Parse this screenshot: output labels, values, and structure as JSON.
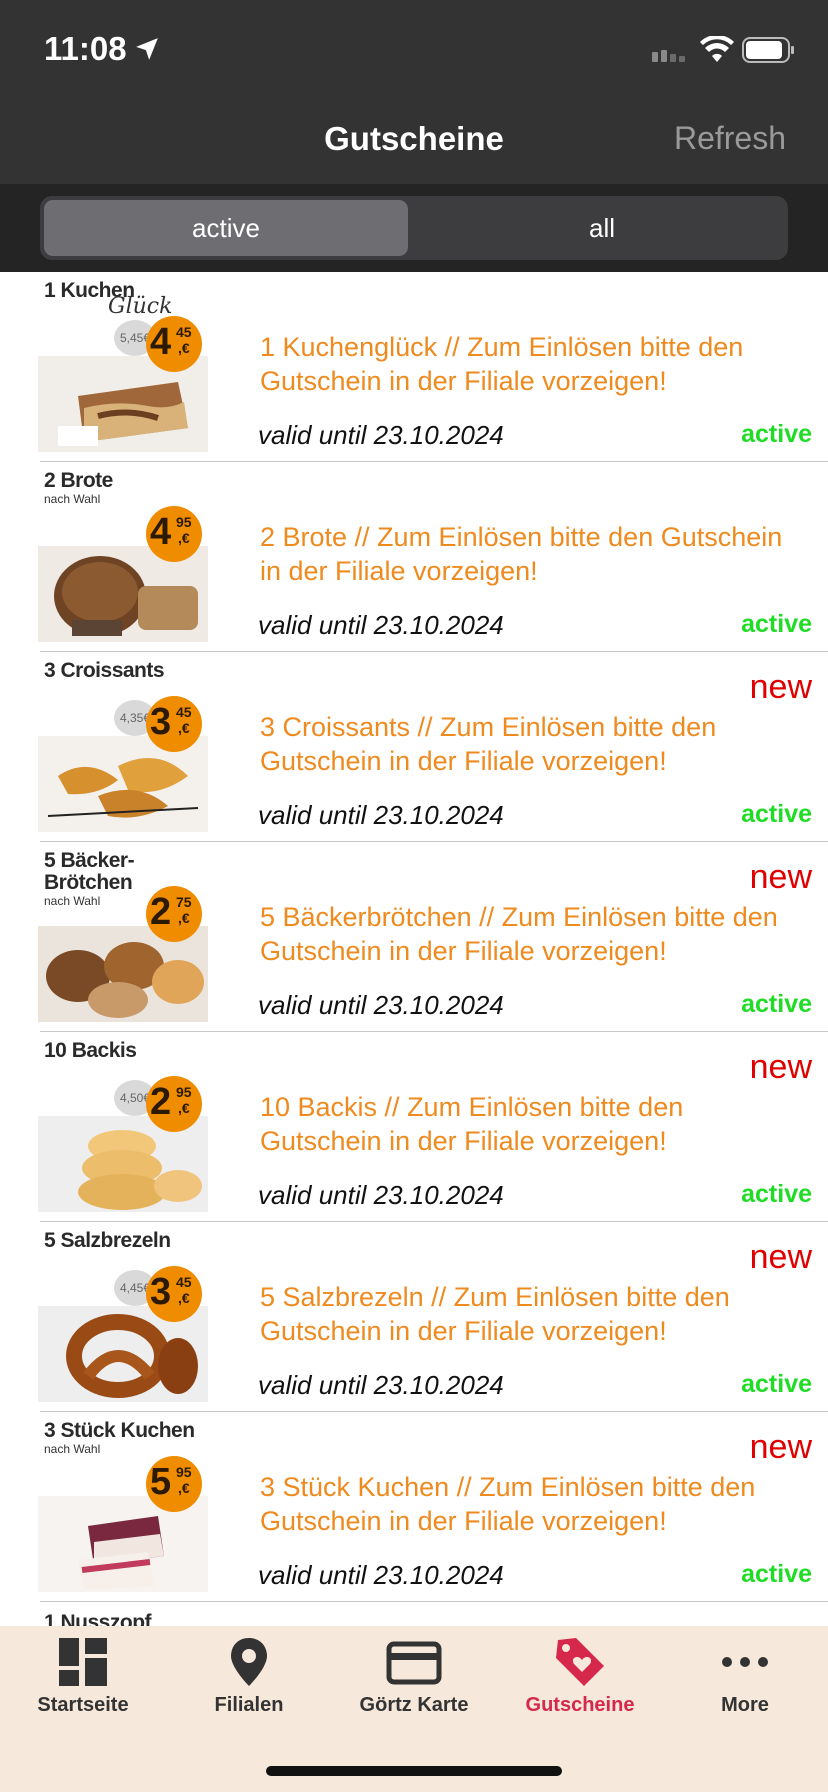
{
  "status_bar": {
    "time": "11:08"
  },
  "nav": {
    "title": "Gutscheine",
    "refresh_label": "Refresh"
  },
  "segments": {
    "active": "active",
    "all": "all"
  },
  "coupons": [
    {
      "image_label": "1 Kuchen",
      "image_script": "Glück",
      "price_main": "4",
      "price_cents": "45",
      "old_price": "5,45€",
      "title": "1 Kuchenglück // Zum Einlösen bitte den Gutschein in der Filiale vorzeigen!",
      "valid": "valid until 23.10.2024",
      "status": "active",
      "is_new": false,
      "new_label": ""
    },
    {
      "image_label": "2 Brote",
      "image_sub": "nach Wahl",
      "price_main": "4",
      "price_cents": "95",
      "old_price": "",
      "title": "2 Brote // Zum Einlösen bitte den Gutschein in der Filiale vorzeigen!",
      "valid": "valid until 23.10.2024",
      "status": "active",
      "is_new": false,
      "new_label": ""
    },
    {
      "image_label": "3 Croissants",
      "price_main": "3",
      "price_cents": "45",
      "old_price": "4,35€",
      "title": "3 Croissants // Zum Einlösen bitte den Gutschein in der Filiale vorzeigen!",
      "valid": "valid until 23.10.2024",
      "status": "active",
      "is_new": true,
      "new_label": "new"
    },
    {
      "image_label": "5 Bäcker-\nBrötchen",
      "image_sub": "nach Wahl",
      "price_main": "2",
      "price_cents": "75",
      "old_price": "",
      "title": "5 Bäckerbrötchen // Zum Einlösen bitte den Gutschein in der Filiale vorzeigen!",
      "valid": "valid until 23.10.2024",
      "status": "active",
      "is_new": true,
      "new_label": "new"
    },
    {
      "image_label": "10 Backis",
      "price_main": "2",
      "price_cents": "95",
      "old_price": "4,50€",
      "title": "10 Backis // Zum Einlösen bitte den Gutschein in der Filiale vorzeigen!",
      "valid": "valid until 23.10.2024",
      "status": "active",
      "is_new": true,
      "new_label": "new"
    },
    {
      "image_label": "5 Salzbrezeln",
      "price_main": "3",
      "price_cents": "45",
      "old_price": "4,45€",
      "title": "5 Salzbrezeln // Zum Einlösen bitte den Gutschein in der Filiale vorzeigen!",
      "valid": "valid until 23.10.2024",
      "status": "active",
      "is_new": true,
      "new_label": "new"
    },
    {
      "image_label": "3 Stück Kuchen",
      "image_sub": "nach Wahl",
      "price_main": "5",
      "price_cents": "95",
      "old_price": "",
      "title": "3 Stück Kuchen // Zum Einlösen bitte den Gutschein in der Filiale vorzeigen!",
      "valid": "valid until 23.10.2024",
      "status": "active",
      "is_new": true,
      "new_label": "new"
    }
  ],
  "partial_coupon": {
    "image_label": "1 Nusszopf"
  },
  "tabs": [
    {
      "label": "Startseite",
      "icon": "dashboard-icon",
      "active": false
    },
    {
      "label": "Filialen",
      "icon": "location-pin-icon",
      "active": false
    },
    {
      "label": "Görtz Karte",
      "icon": "card-icon",
      "active": false
    },
    {
      "label": "Gutscheine",
      "icon": "tag-heart-icon",
      "active": true
    },
    {
      "label": "More",
      "icon": "more-dots-icon",
      "active": false
    }
  ],
  "colors": {
    "header_bg": "#333333",
    "title_orange": "#ee8a1e",
    "status_green": "#1fdc25",
    "new_red": "#e00000",
    "tab_active": "#d6284a",
    "tabbar_bg": "#f6e8da",
    "price_badge": "#f08c00"
  }
}
